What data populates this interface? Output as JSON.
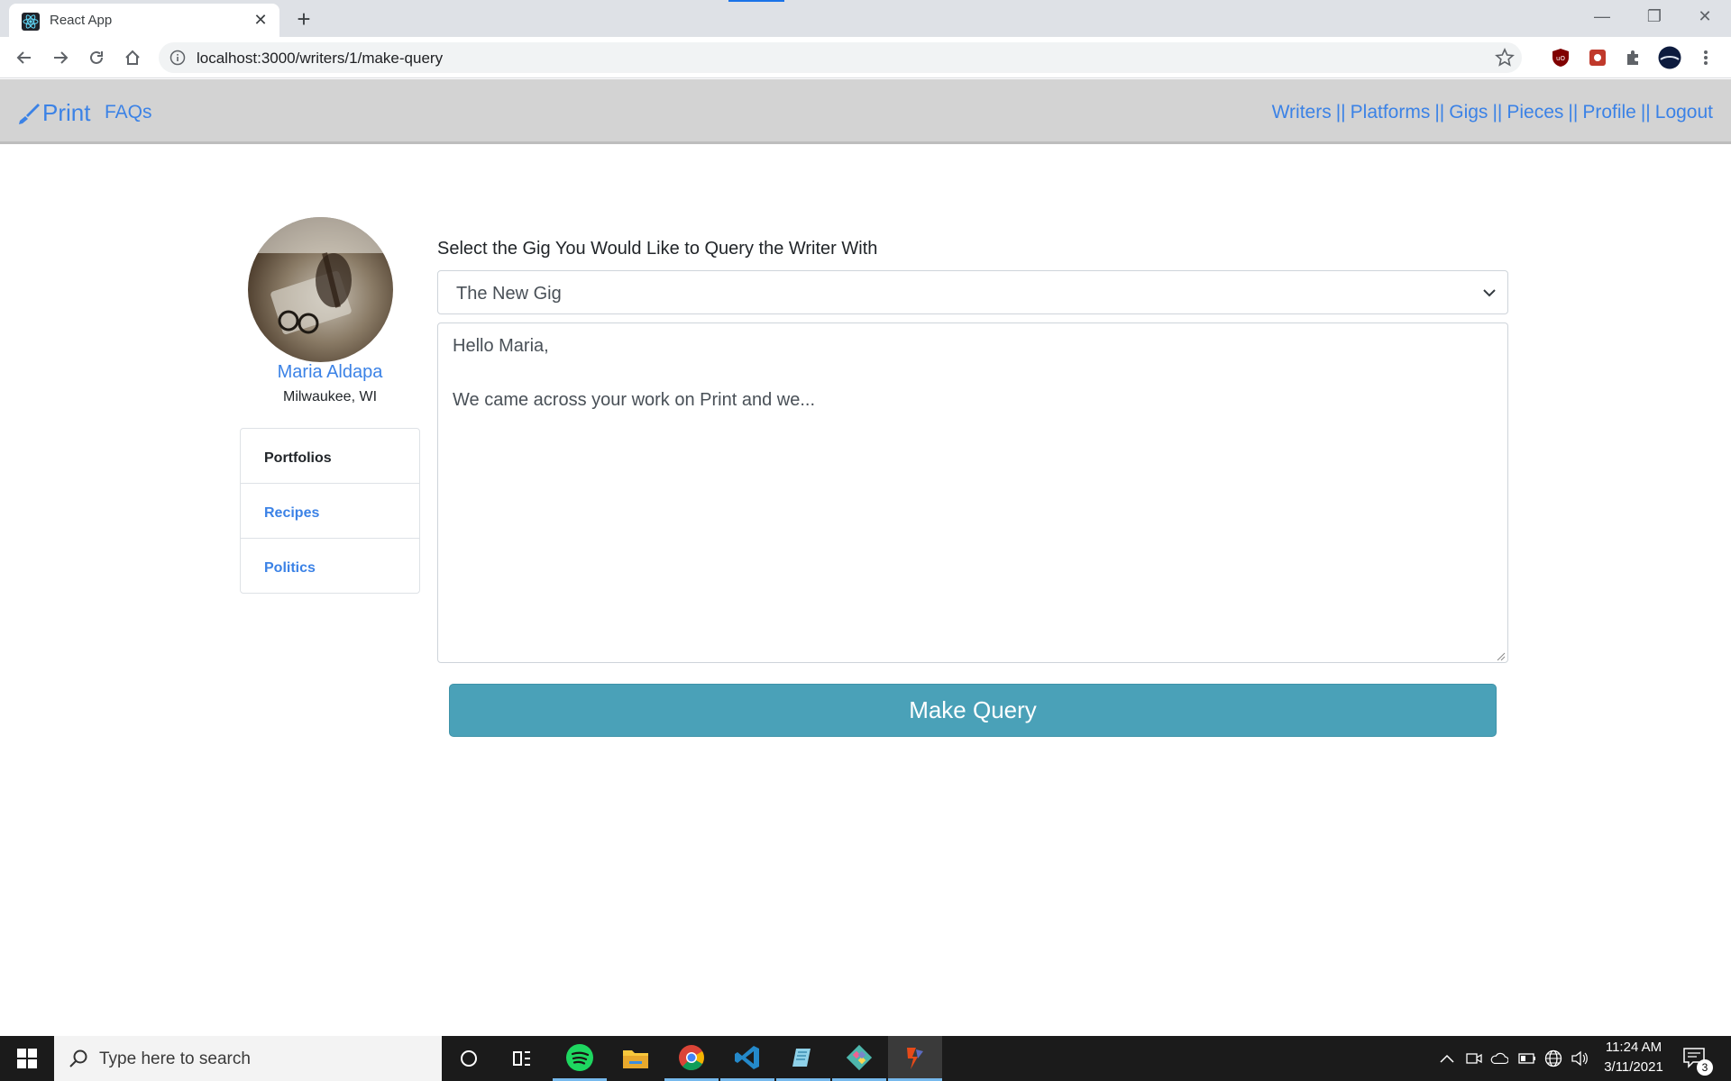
{
  "browser": {
    "tab_title": "React App",
    "url": "localhost:3000/writers/1/make-query"
  },
  "navbar": {
    "brand": "Print",
    "faq": "FAQs",
    "links": [
      "Writers",
      "Platforms",
      "Gigs",
      "Pieces",
      "Profile",
      "Logout"
    ],
    "separator": "||"
  },
  "writer": {
    "name": "Maria Aldapa",
    "location": "Milwaukee, WI"
  },
  "portfolios": {
    "header": "Portfolios",
    "items": [
      "Recipes",
      "Politics"
    ]
  },
  "form": {
    "label": "Select the Gig You Would Like to Query the Writer With",
    "selected_gig": "The New Gig",
    "message_line1": "Hello Maria,",
    "message_line2": "We came across your work on Print and we...",
    "submit_label": "Make Query"
  },
  "taskbar": {
    "search_placeholder": "Type here to search",
    "time": "11:24 AM",
    "date": "3/11/2021",
    "notification_count": "3"
  },
  "colors": {
    "link": "#3b82e6",
    "navbar_bg": "#d3d3d3",
    "button": "#4aa1b8"
  }
}
